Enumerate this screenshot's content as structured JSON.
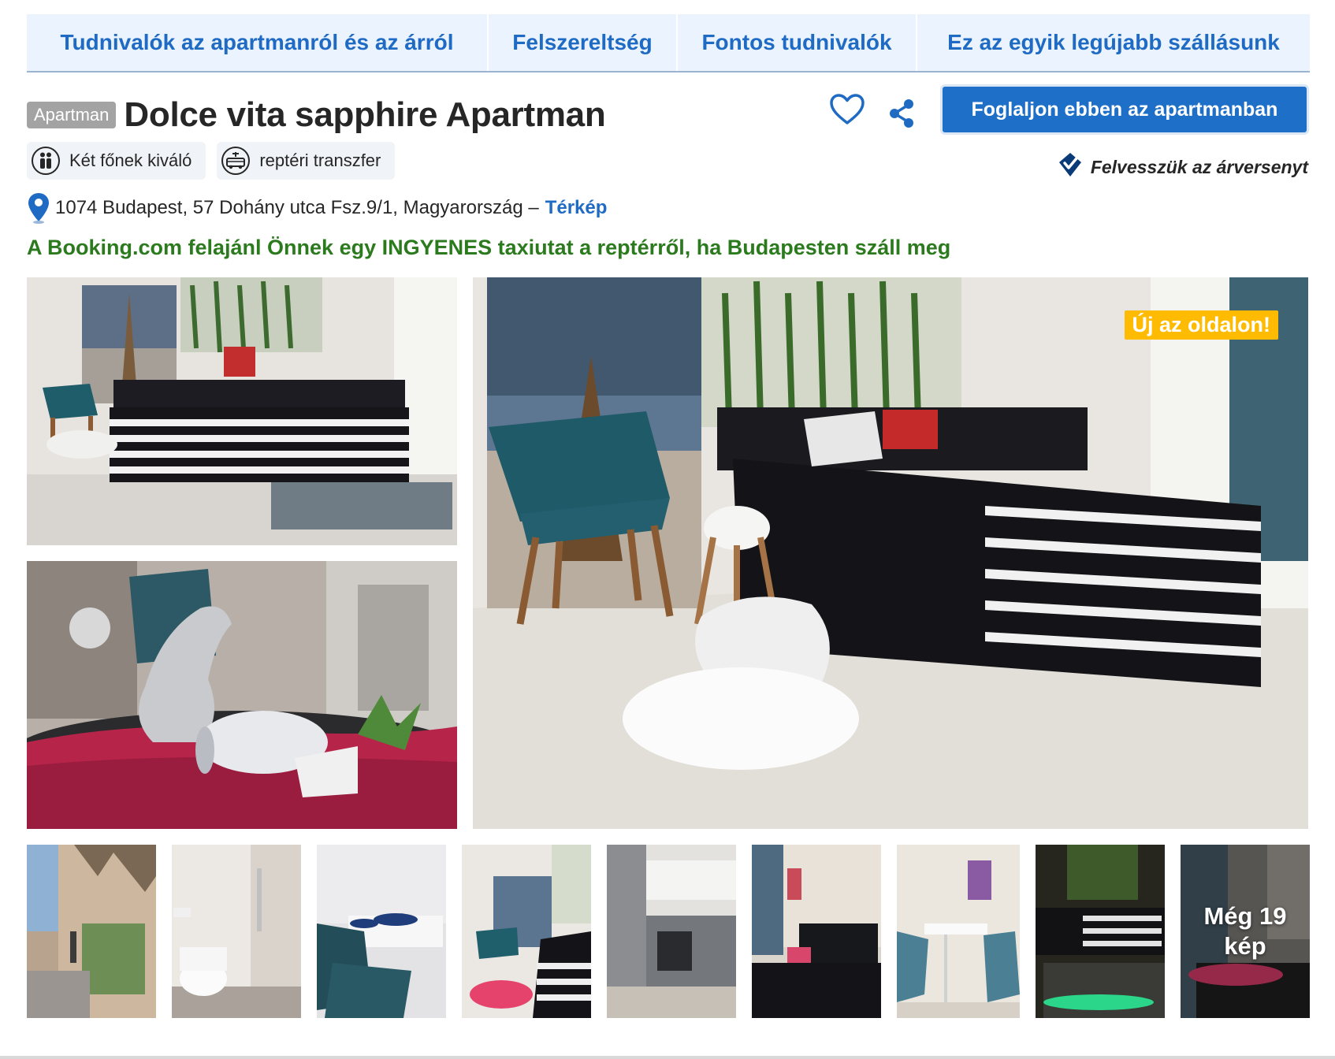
{
  "tabs": [
    {
      "label": "Tudnivalók az apartmanról és az árról"
    },
    {
      "label": "Felszereltség"
    },
    {
      "label": "Fontos tudnivalók"
    },
    {
      "label": "Ez az egyik legújabb szállásunk"
    }
  ],
  "property": {
    "type_badge": "Apartman",
    "title": "Dolce vita sapphire Apartman",
    "book_button": "Foglaljon ebben az apartmanban",
    "price_match": "Felvesszük az árversenyt",
    "highlights": [
      {
        "icon": "two-people-icon",
        "label": "Két főnek kiváló"
      },
      {
        "icon": "airport-shuttle-icon",
        "label": "reptéri transzfer"
      }
    ],
    "address": "1074 Budapest, 57 Dohány utca Fsz.9/1, Magyarország –",
    "map_link": "Térkép",
    "promo": "A Booking.com felajánl Önnek egy INGYENES taxiutat a reptérről, ha Budapesten száll meg"
  },
  "gallery": {
    "new_badge": "Új az oldalon!",
    "more_photos_line1": "Még 19",
    "more_photos_line2": "kép"
  },
  "colors": {
    "accent": "#1f6bc4",
    "button": "#1d6fc7",
    "promo": "#2b7a1d",
    "badge": "#febb02",
    "tab_bg": "#ebf3ff"
  }
}
